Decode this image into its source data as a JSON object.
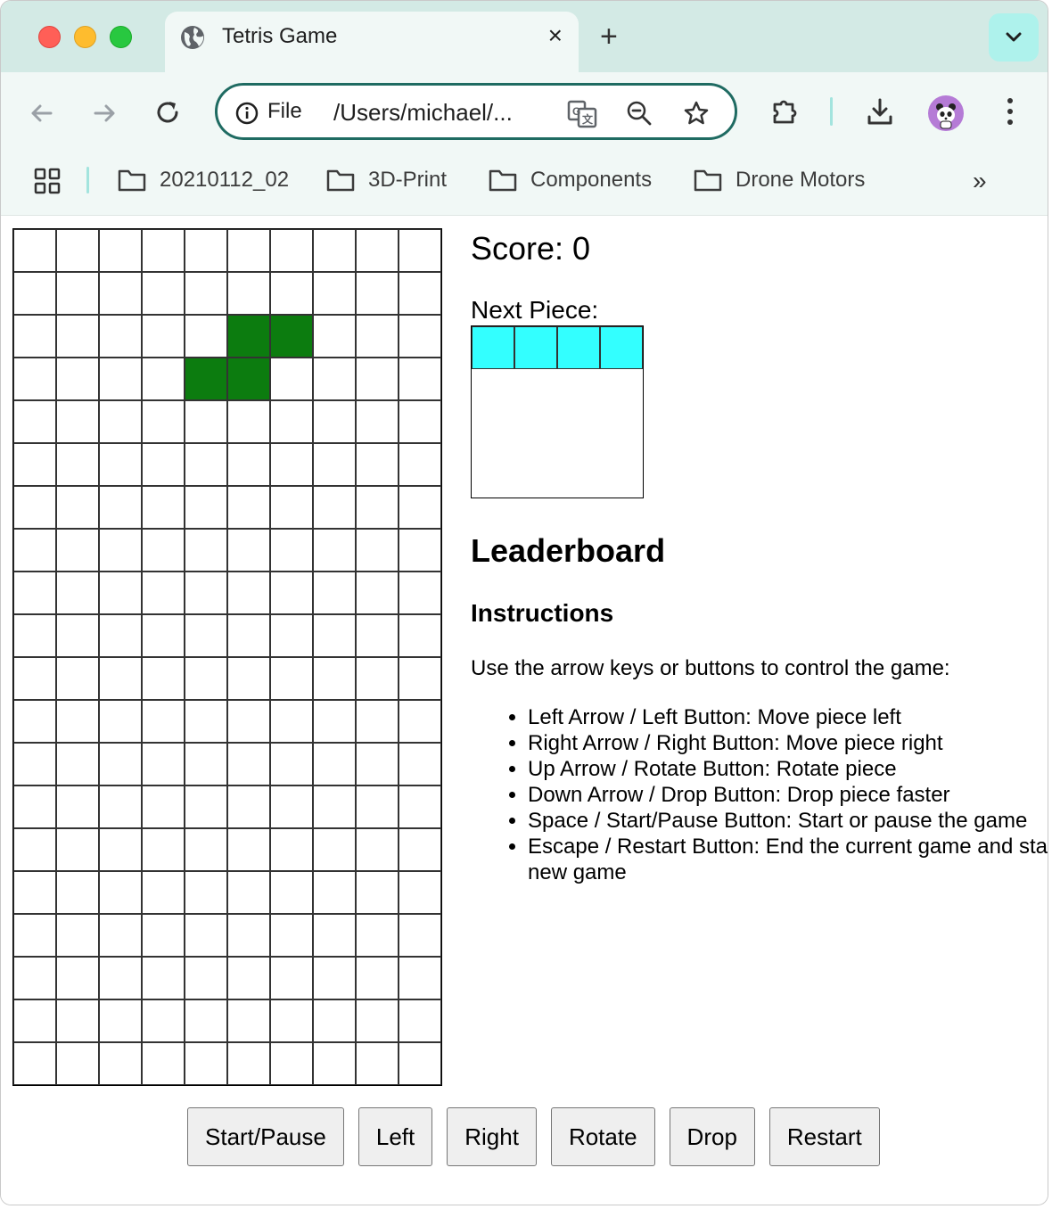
{
  "browser": {
    "tab_title": "Tetris Game",
    "tab_close": "×",
    "new_tab": "+",
    "omnibox_scheme": "File",
    "omnibox_url": "/Users/michael/...",
    "bookmarks": [
      "20210112_02",
      "3D-Print",
      "Components",
      "Drone Motors"
    ],
    "bookmarks_more": "»",
    "accent_color": "#1f6b62"
  },
  "game": {
    "score_label": "Score: 0",
    "score": 0,
    "next_piece_label": "Next Piece:",
    "board_cols": 10,
    "board_rows": 20,
    "current_piece": {
      "color": "#0c7c0f",
      "cells": [
        [
          2,
          5
        ],
        [
          2,
          6
        ],
        [
          3,
          4
        ],
        [
          3,
          5
        ]
      ]
    },
    "next_piece": {
      "color": "#33ffff",
      "cells": [
        [
          0,
          0
        ],
        [
          0,
          1
        ],
        [
          0,
          2
        ],
        [
          0,
          3
        ]
      ]
    },
    "leaderboard_title": "Leaderboard",
    "instructions_title": "Instructions",
    "instructions_intro": "Use the arrow keys or buttons to control the game:",
    "instructions": [
      "Left Arrow / Left Button: Move piece left",
      "Right Arrow / Right Button: Move piece right",
      "Up Arrow / Rotate Button: Rotate piece",
      "Down Arrow / Drop Button: Drop piece faster",
      "Space / Start/Pause Button: Start or pause the game",
      "Escape / Restart Button: End the current game and start a new game"
    ],
    "buttons": {
      "start_pause": "Start/Pause",
      "left": "Left",
      "right": "Right",
      "rotate": "Rotate",
      "drop": "Drop",
      "restart": "Restart"
    }
  }
}
